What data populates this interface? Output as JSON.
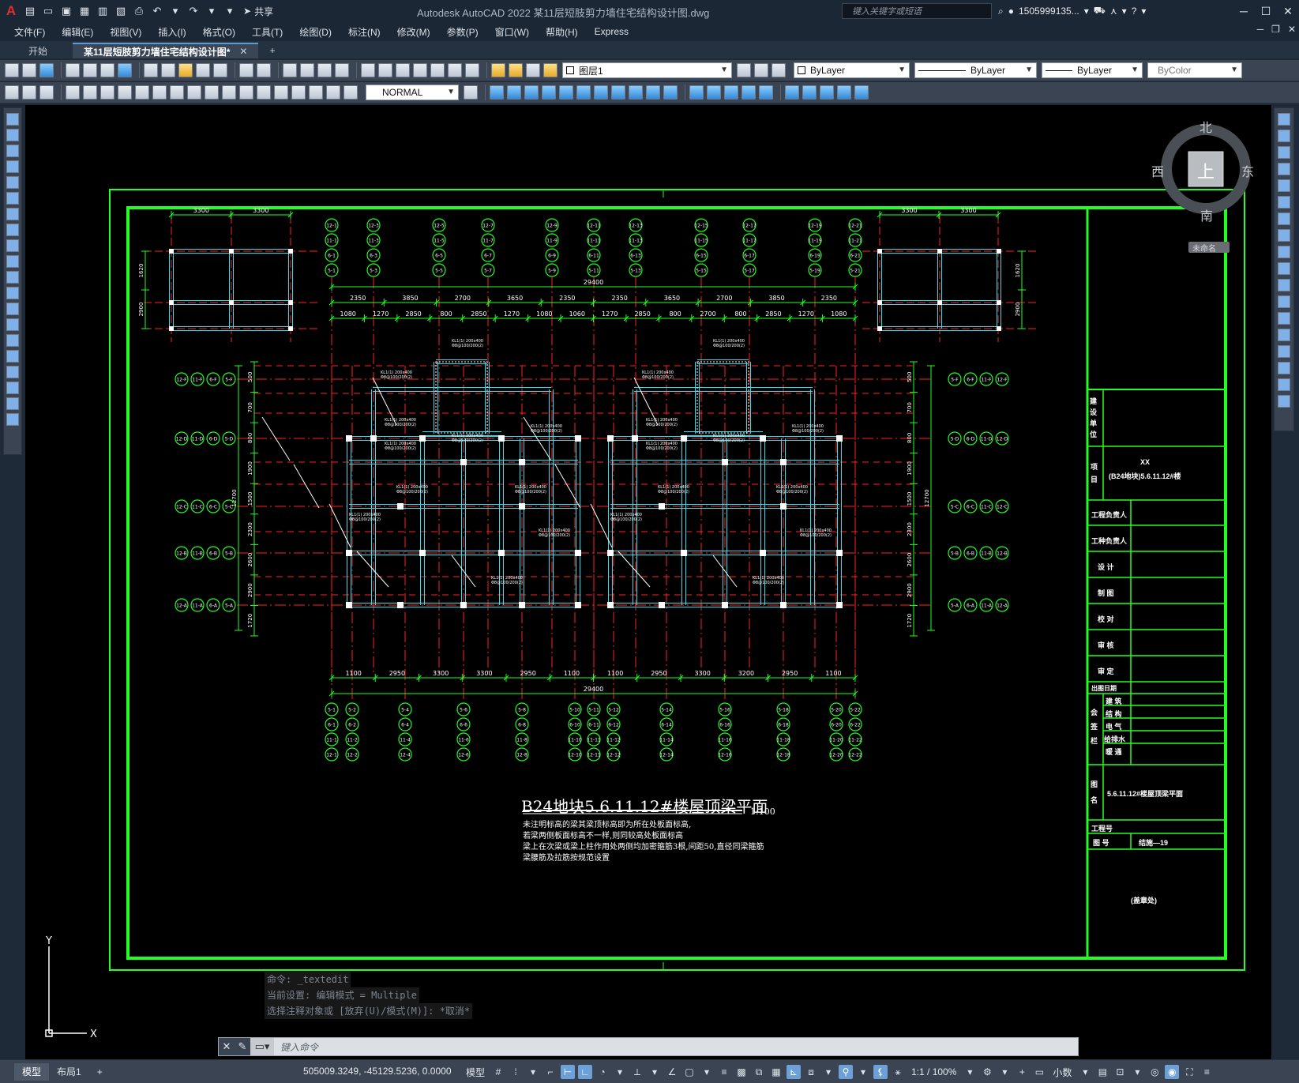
{
  "app": {
    "title": "Autodesk AutoCAD 2022    某11层短肢剪力墙住宅结构设计图.dwg",
    "logo": "A",
    "share_label": "共享",
    "search_placeholder": "键入关键字或短语",
    "user": "1505999135...",
    "help": "?"
  },
  "menu": {
    "items": [
      "文件(F)",
      "编辑(E)",
      "视图(V)",
      "插入(I)",
      "格式(O)",
      "工具(T)",
      "绘图(D)",
      "标注(N)",
      "修改(M)",
      "参数(P)",
      "窗口(W)",
      "帮助(H)",
      "Express"
    ]
  },
  "tabs": {
    "start": "开始",
    "doc": "某11层短肢剪力墙住宅结构设计图*",
    "close": "✕",
    "add": "+"
  },
  "toolbar": {
    "layer": "图层1",
    "color": "ByLayer",
    "linetype": "ByLayer",
    "lineweight": "ByLayer",
    "plotstyle": "ByColor",
    "textstyle": "NORMAL"
  },
  "compass": {
    "north": "北",
    "south": "南",
    "east": "东",
    "west": "西",
    "top": "上",
    "unnamed": "未命名"
  },
  "drawing": {
    "main_title": "B24地块5.6.11.12#楼屋顶梁平面",
    "scale": "1:100",
    "notes": [
      "未注明标高的梁其梁顶标高即为所在处板面标高,",
      "若梁两侧板面标高不一样,则同较高处板面标高",
      "梁上在次梁或梁上柱作用处两侧均加密箍筋3根,间距50,直径同梁箍筋",
      "梁腰筋及拉筋按规范设置"
    ],
    "dims_top_main": "29400",
    "dims_top_row1": [
      "2350",
      "3850",
      "2700",
      "3650",
      "2350",
      "2350",
      "3650",
      "2700",
      "3850",
      "2350"
    ],
    "dims_top_row2": [
      "1080",
      "1270",
      "2850",
      "800",
      "2850",
      "1270",
      "1080",
      "1060",
      "1270",
      "2850",
      "800",
      "2700",
      "800",
      "2850",
      "1270",
      "1080"
    ],
    "dims_bot_main": "29400",
    "dims_bot_row": [
      "1100",
      "2950",
      "3300",
      "3300",
      "2950",
      "1100",
      "1100",
      "2950",
      "3300",
      "3200",
      "2950",
      "1100"
    ],
    "dims_left": [
      "1720",
      "2900",
      "2600",
      "2300",
      "1500",
      "1900",
      "800",
      "700",
      "500"
    ],
    "dims_inset": [
      "3300",
      "3300"
    ],
    "dims_inset_side": [
      "2900",
      "1620"
    ],
    "grid_labels_top": [
      [
        "12-1",
        "11-1",
        "6-1",
        "5-1"
      ],
      [
        "12-3",
        "11-3",
        "6-3",
        "5-3"
      ],
      [
        "12-5",
        "11-5",
        "6-5",
        "5-5"
      ],
      [
        "12-7",
        "11-7",
        "6-7",
        "5-7"
      ],
      [
        "12-9",
        "11-9",
        "6-9",
        "5-9"
      ],
      [
        "12-11",
        "11-11",
        "6-11",
        "5-11"
      ],
      [
        "12-13",
        "11-13",
        "6-13",
        "5-13"
      ],
      [
        "12-15",
        "11-15",
        "6-15",
        "5-15"
      ],
      [
        "12-17",
        "11-17",
        "6-17",
        "5-17"
      ],
      [
        "12-19",
        "11-19",
        "6-19",
        "5-19"
      ],
      [
        "12-21",
        "11-21",
        "6-21",
        "5-21"
      ]
    ],
    "grid_labels_bot": [
      [
        "5-1",
        "6-1",
        "11-1",
        "12-1"
      ],
      [
        "5-2",
        "6-2",
        "11-2",
        "12-2"
      ],
      [
        "5-4",
        "6-4",
        "11-4",
        "12-4"
      ],
      [
        "5-6",
        "6-6",
        "11-6",
        "12-6"
      ],
      [
        "5-8",
        "6-8",
        "11-8",
        "12-8"
      ],
      [
        "5-10",
        "6-10",
        "11-10",
        "12-10"
      ],
      [
        "5-11",
        "6-11",
        "11-11",
        "12-11"
      ],
      [
        "5-12",
        "6-12",
        "11-12",
        "12-12"
      ],
      [
        "5-14",
        "6-14",
        "11-14",
        "12-14"
      ],
      [
        "5-16",
        "6-16",
        "11-16",
        "12-16"
      ],
      [
        "5-18",
        "6-18",
        "11-18",
        "12-18"
      ],
      [
        "5-20",
        "6-20",
        "11-20",
        "12-20"
      ],
      [
        "5-22",
        "6-22",
        "11-22",
        "12-22"
      ]
    ],
    "grid_labels_left": [
      [
        "12-F",
        "11-F",
        "6-F",
        "5-F"
      ],
      [
        "12-D",
        "11-D",
        "6-D",
        "5-D"
      ],
      [
        "12-C",
        "11-C",
        "6-C",
        "5-C"
      ],
      [
        "12-B",
        "11-B",
        "6-B",
        "5-B"
      ],
      [
        "12-A",
        "11-A",
        "6-A",
        "5-A"
      ]
    ],
    "grid_labels_right": [
      [
        "5-F",
        "6-F",
        "11-F",
        "12-F"
      ],
      [
        "5-D",
        "6-D",
        "11-D",
        "12-D"
      ],
      [
        "5-C",
        "6-C",
        "11-C",
        "12-C"
      ],
      [
        "5-B",
        "6-B",
        "11-B",
        "12-B"
      ],
      [
        "5-A",
        "6-A",
        "11-A",
        "12-A"
      ]
    ]
  },
  "title_block": {
    "org": "建设单位",
    "project_lbl": "项目",
    "project": "XX",
    "project2": "(B24地块)5.6.11.12#楼",
    "rows": [
      "工程负责人",
      "工种负责人",
      "设 计",
      "制 图",
      "校 对",
      "审 核",
      "审 定",
      "出图日期"
    ],
    "sign_lbl": "会签栏",
    "sign_rows": [
      "建 筑",
      "结 构",
      "电 气",
      "给排水",
      "暖 通"
    ],
    "drawing_name_lbl": "图名",
    "drawing_name": "5.6.11.12#楼屋顶梁平面",
    "project_no": "工程号",
    "sheet_no_lbl": "图 号",
    "sheet_no": "结施—19",
    "stamp": "(盖章处)"
  },
  "command": {
    "history": [
      "命令: _textedit",
      "当前设置: 编辑模式 = Multiple",
      "选择注释对象或 [放弃(U)/模式(M)]: *取消*"
    ],
    "placeholder": "键入命令"
  },
  "status": {
    "tab_model": "模型",
    "tab_layout": "布局1",
    "add": "+",
    "coords": "505009.3249, -45129.5236, 0.0000",
    "space": "模型",
    "scale": "1:1 / 100%",
    "units": "小数"
  },
  "colors": {
    "frame": "#22ff22",
    "axis": "#ff2222",
    "beam": "#33ddee",
    "dim": "#22ff22"
  }
}
